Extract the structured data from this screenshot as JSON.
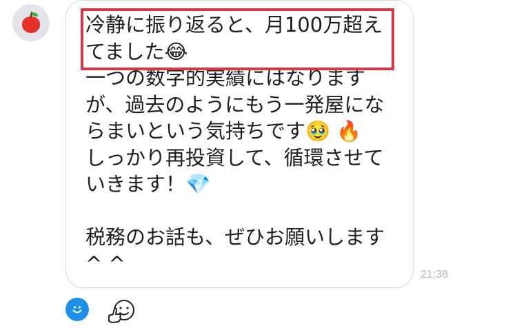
{
  "message": {
    "highlighted_lines": [
      "冷静に振り返ると、月100万超え",
      "てました😂"
    ],
    "lines": [
      "一つの数字的実績にはなります",
      "が、過去のようにもう一発屋にな",
      "らまいという気持ちです🥹 🔥",
      "しっかり再投資して、循環させて",
      "いきます！💎",
      "",
      "税務のお話も、ぜひお願いします",
      "^ ^"
    ],
    "time": "21:38"
  },
  "icons": {
    "avatar": "apple-avatar",
    "reaction": "smiley-reaction-icon",
    "stamp": "stamp-thumbs-icon"
  },
  "colors": {
    "highlight_border": "#d4384a",
    "reaction_button": "#1e8fe6",
    "time": "#b0b4bc"
  }
}
